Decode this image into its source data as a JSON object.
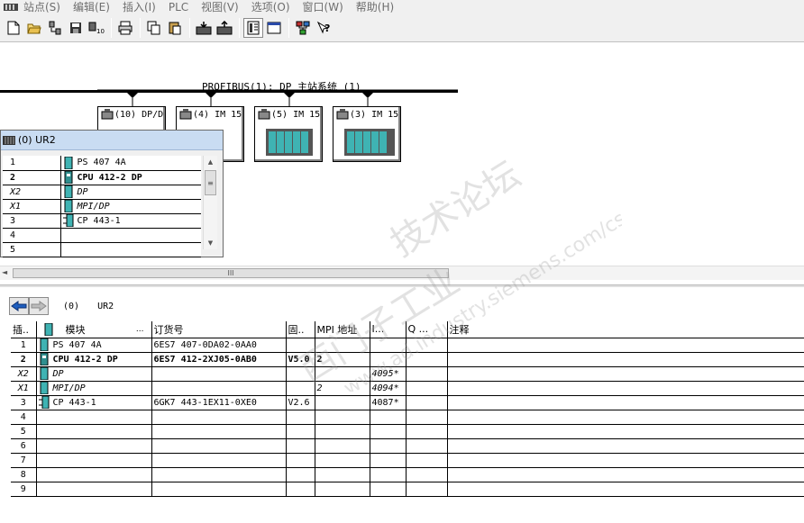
{
  "menu": {
    "items": [
      "站点(S)",
      "编辑(E)",
      "插入(I)",
      "PLC",
      "视图(V)",
      "选项(O)",
      "窗口(W)",
      "帮助(H)"
    ]
  },
  "network": {
    "label": "PROFIBUS(1): DP 主站系统 (1)",
    "stations": [
      {
        "label": "(10) DP/D"
      },
      {
        "label": "(4) IM 15"
      },
      {
        "label": "(5) IM 15"
      },
      {
        "label": "(3) IM 15"
      }
    ]
  },
  "ur2_window": {
    "title": "(0) UR2",
    "rows": [
      {
        "slot": "1",
        "module": "PS 407 4A",
        "style": "normal"
      },
      {
        "slot": "2",
        "module": "CPU 412-2 DP",
        "style": "bold"
      },
      {
        "slot": "X2",
        "module": "DP",
        "style": "italic"
      },
      {
        "slot": "X1",
        "module": "MPI/DP",
        "style": "italic"
      },
      {
        "slot": "3",
        "module": "CP 443-1",
        "style": "normal"
      },
      {
        "slot": "4",
        "module": "",
        "style": "normal"
      },
      {
        "slot": "5",
        "module": "",
        "style": "normal"
      }
    ]
  },
  "detail": {
    "rack_number": "(0)",
    "rack_name": "UR2",
    "columns": [
      "插..",
      "模块",
      "订货号",
      "固..",
      "MPI 地址",
      "I...",
      "Q ...",
      "注释"
    ],
    "module_col_dots": "...",
    "rows": [
      {
        "slot": "1",
        "module": "PS 407 4A",
        "order": "6ES7 407-0DA02-0AA0",
        "fw": "",
        "mpi": "",
        "i": "",
        "q": "",
        "comment": "",
        "style": "normal"
      },
      {
        "slot": "2",
        "module": "CPU 412-2 DP",
        "order": "6ES7 412-2XJ05-0AB0",
        "fw": "V5.0",
        "mpi": "2",
        "i": "",
        "q": "",
        "comment": "",
        "style": "bold"
      },
      {
        "slot": "X2",
        "module": "DP",
        "order": "",
        "fw": "",
        "mpi": "",
        "i": "4095*",
        "q": "",
        "comment": "",
        "style": "italic"
      },
      {
        "slot": "X1",
        "module": "MPI/DP",
        "order": "",
        "fw": "",
        "mpi": "2",
        "i": "4094*",
        "q": "",
        "comment": "",
        "style": "italic"
      },
      {
        "slot": "3",
        "module": "CP 443-1",
        "order": "6GK7 443-1EX11-0XE0",
        "fw": "V2.6",
        "mpi": "",
        "i": "4087*",
        "q": "",
        "comment": "",
        "style": "normal"
      },
      {
        "slot": "4",
        "module": "",
        "order": "",
        "fw": "",
        "mpi": "",
        "i": "",
        "q": "",
        "comment": "",
        "style": "normal"
      },
      {
        "slot": "5",
        "module": "",
        "order": "",
        "fw": "",
        "mpi": "",
        "i": "",
        "q": "",
        "comment": "",
        "style": "normal"
      },
      {
        "slot": "6",
        "module": "",
        "order": "",
        "fw": "",
        "mpi": "",
        "i": "",
        "q": "",
        "comment": "",
        "style": "normal"
      },
      {
        "slot": "7",
        "module": "",
        "order": "",
        "fw": "",
        "mpi": "",
        "i": "",
        "q": "",
        "comment": "",
        "style": "normal"
      },
      {
        "slot": "8",
        "module": "",
        "order": "",
        "fw": "",
        "mpi": "",
        "i": "",
        "q": "",
        "comment": "",
        "style": "normal"
      },
      {
        "slot": "9",
        "module": "",
        "order": "",
        "fw": "",
        "mpi": "",
        "i": "",
        "q": "",
        "comment": "",
        "style": "normal"
      }
    ]
  },
  "watermark": {
    "line1": "西门子工业",
    "line2": "技术论坛",
    "line3": "www.ad.industry.siemens.com/cs"
  },
  "colors": {
    "window_title_bg": "#c9dcf2",
    "rack_module": "#3fb3b3",
    "nav_arrow": "#1f5fbf"
  }
}
